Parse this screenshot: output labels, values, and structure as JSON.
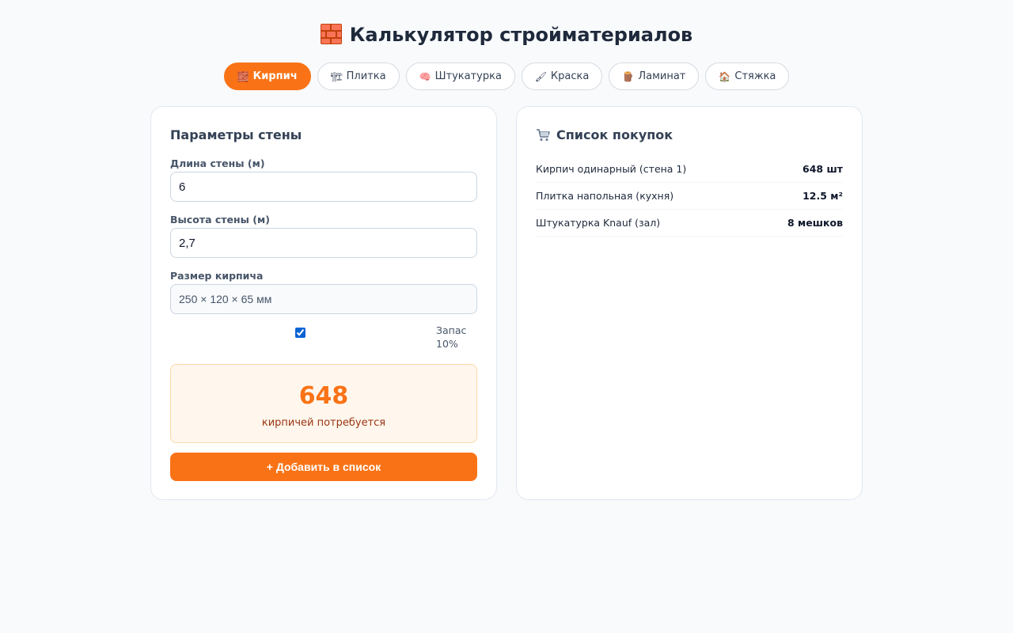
{
  "header": {
    "title": "Калькулятор стройматериалов",
    "icon": "brick-icon"
  },
  "tabs": [
    {
      "label": "Кирпич",
      "icon": "brick-icon",
      "active": true
    },
    {
      "label": "Плитка",
      "icon": "tile-icon",
      "active": false
    },
    {
      "label": "Штукатурка",
      "icon": "plaster-icon",
      "active": false
    },
    {
      "label": "Краска",
      "icon": "paint-icon",
      "active": false
    },
    {
      "label": "Ламинат",
      "icon": "laminate-icon",
      "active": false
    },
    {
      "label": "Стяжка",
      "icon": "screed-icon",
      "active": false
    }
  ],
  "form": {
    "title": "Параметры стены",
    "length_label": "Длина стены (м)",
    "length_value": "6",
    "height_label": "Высота стены (м)",
    "height_value": "2,7",
    "brick_size_label": "Размер кирпича",
    "brick_size_value": "250 × 120 × 65 мм",
    "reserve_label": "Запас 10%",
    "reserve_checked": true,
    "result_value": "648",
    "result_caption": "кирпичей потребуется",
    "add_button": "+ Добавить в список"
  },
  "cart": {
    "title": "Список покупок",
    "items": [
      {
        "name": "Кирпич одинарный (стена 1)",
        "qty": "648 шт"
      },
      {
        "name": "Плитка напольная (кухня)",
        "qty": "12.5 м²"
      },
      {
        "name": "Штукатурка Knauf (зал)",
        "qty": "8 мешков"
      }
    ]
  },
  "colors": {
    "accent": "#f97316",
    "background": "#f8fafc",
    "result_bg": "#fff7ed"
  }
}
